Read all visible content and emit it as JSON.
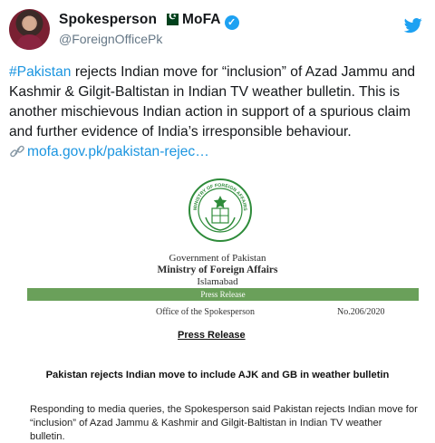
{
  "tweet": {
    "author_name": "Spokesperson",
    "org_name": "MoFA",
    "handle": "@ForeignOfficePk",
    "hashtag": "#Pakistan",
    "body": " rejects Indian move for “inclusion” of Azad Jammu and Kashmir & Gilgit-Baltistan in Indian TV weather bulletin. This is another mischievous Indian action in support of a spurious claim and further evidence of India’s irresponsible behaviour.",
    "link_text": "mofa.gov.pk/pakistan-rejec…",
    "icons": {
      "avatar": "avatar",
      "flag": "pakistan-flag-icon",
      "verified": "verified-badge-icon",
      "bird": "twitter-bird-icon",
      "link": "link-icon"
    },
    "colors": {
      "link": "#1b95e0",
      "handle": "#657786",
      "twitter": "#1da1f2"
    }
  },
  "document": {
    "gov_line": "Government of Pakistan",
    "ministry": "Ministry of Foreign Affairs",
    "city": "Islamabad",
    "banner": "Press Release",
    "office": "Office of the Spokesperson",
    "number": "No.206/2020",
    "heading": "Press Release",
    "title": "Pakistan rejects Indian move to include AJK and GB in weather bulletin",
    "body": "Responding to media queries, the Spokesperson said Pakistan rejects Indian move for “inclusion” of Azad Jammu & Kashmir and Gilgit-Baltistan in Indian TV weather bulletin.",
    "emblem_ring_text": "MINISTRY OF FOREIGN AFFAIRS · GOVERNMENT OF PAKISTAN",
    "colors": {
      "banner": "#6aa05a",
      "emblem": "#2e8b3a"
    }
  }
}
